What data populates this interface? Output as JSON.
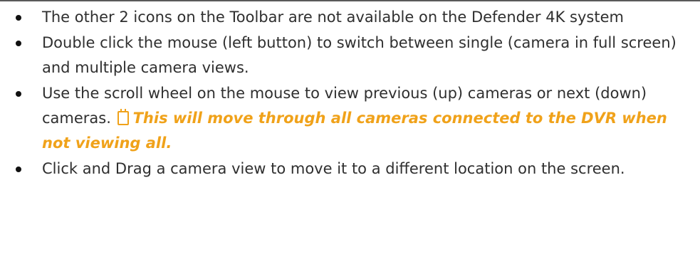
{
  "bullets": [
    {
      "text": "The other 2 icons on the Toolbar are not available on the Defender 4K system"
    },
    {
      "text": "Double click the mouse (left button) to switch between single (camera in full screen) and multiple camera views."
    },
    {
      "text": "Use the scroll wheel on the mouse to view previous (up) cameras or next (down) cameras.",
      "note_icon": "note-icon",
      "note": "This will move through all cameras connected to the DVR when not viewing all."
    },
    {
      "text": "Click and Drag a camera view to move it to a different location on the screen."
    }
  ],
  "colors": {
    "text": "#2f2f2f",
    "note": "#f0a21a",
    "rule": "#5a5a5a"
  }
}
